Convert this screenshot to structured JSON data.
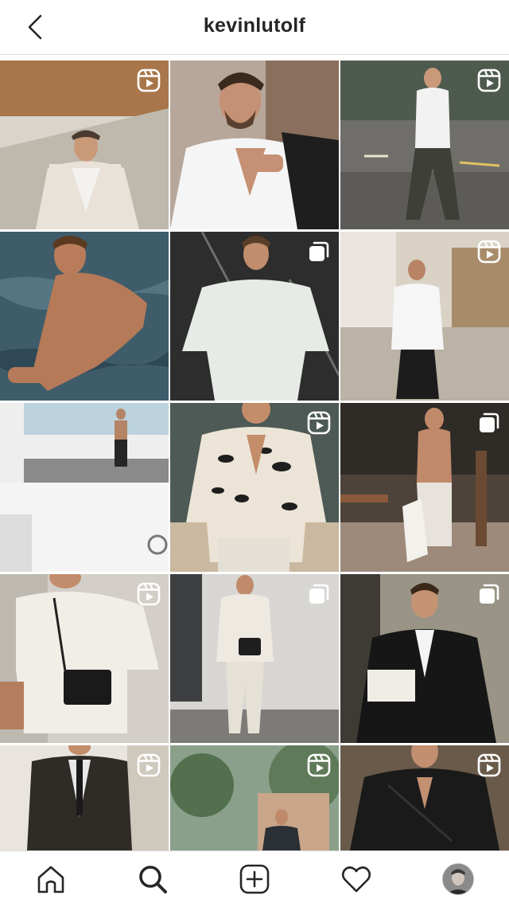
{
  "header": {
    "username": "kevinlutolf",
    "back_icon": "chevron-left-icon"
  },
  "grid": {
    "posts": [
      {
        "type": "reel"
      },
      {
        "type": "photo"
      },
      {
        "type": "reel"
      },
      {
        "type": "photo"
      },
      {
        "type": "carousel"
      },
      {
        "type": "reel"
      },
      {
        "type": "photo"
      },
      {
        "type": "reel"
      },
      {
        "type": "carousel"
      },
      {
        "type": "reel"
      },
      {
        "type": "carousel"
      },
      {
        "type": "carousel"
      },
      {
        "type": "reel"
      },
      {
        "type": "reel"
      },
      {
        "type": "reel"
      }
    ]
  },
  "tabbar": {
    "items": [
      {
        "icon": "home-icon"
      },
      {
        "icon": "search-icon",
        "active": true
      },
      {
        "icon": "new-post-icon"
      },
      {
        "icon": "heart-icon"
      },
      {
        "icon": "profile-avatar"
      }
    ]
  }
}
